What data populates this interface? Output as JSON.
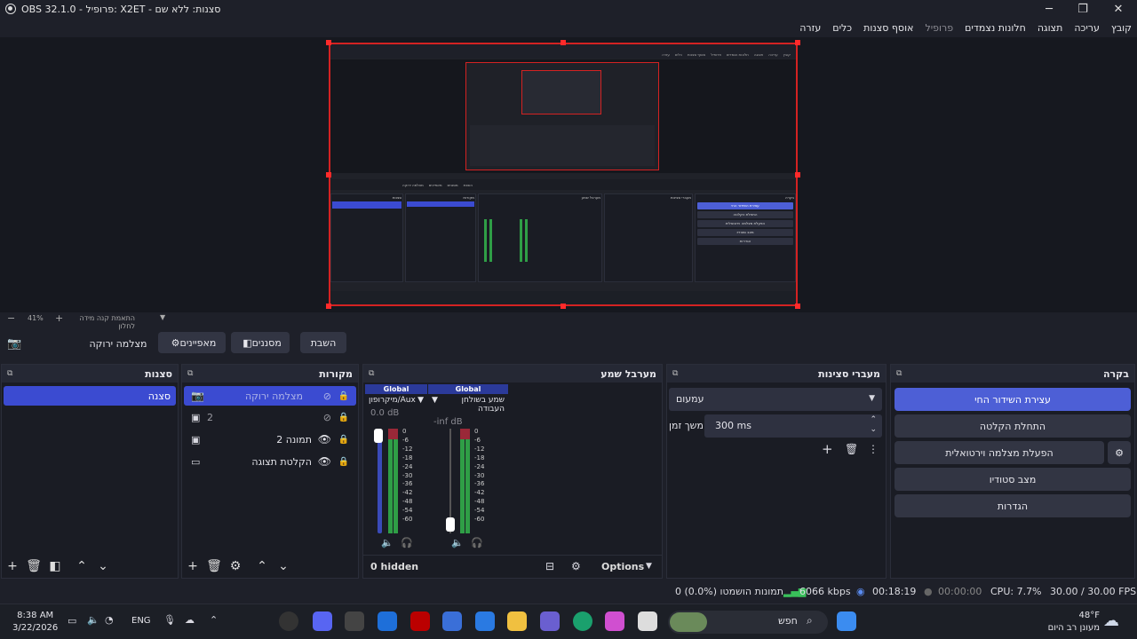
{
  "window": {
    "title": "OBS 32.1.0 - פרופיל: X2ET - סצנות: ללא שם"
  },
  "menu": [
    "קובץ",
    "עריכה",
    "תצוגה",
    "חלונות נצמדים",
    "פרופיל",
    "אוסף סצנות",
    "כלים",
    "עזרה"
  ],
  "nested_preview": {
    "menu": [
      "קובץ",
      "עריכה",
      "תצוגה",
      "חלונות נצמדים",
      "פרופיל",
      "אוסף סצנות",
      "כלים",
      "עזרה"
    ],
    "docks": [
      "סצנות",
      "מקורות",
      "מערבל שמע",
      "מעברי סצינות",
      "בקרה"
    ],
    "buttons": [
      "מצלמה ירוקה",
      "מאפיינים",
      "מסננים",
      "השבת"
    ],
    "controls": [
      "עצירת השידור החי",
      "התחלת הקלטה",
      "הפעלת מצלמה וירטואלית",
      "מצב סטודיו",
      "הגדרות"
    ]
  },
  "zoom": {
    "value": "41%",
    "mode": "התאמת קנה מידה לחלון"
  },
  "source_controls": {
    "selected": "מצלמה ירוקה",
    "properties": "מאפיינים",
    "filters": "מסננים",
    "deactivate": "השבת"
  },
  "scenes": {
    "title": "סצנות",
    "items": [
      "סצנה"
    ]
  },
  "sources": {
    "title": "מקורות",
    "items": [
      {
        "name": "מצלמה ירוקה",
        "icon": "camera-icon",
        "visible": false,
        "selected": true
      },
      {
        "name": "2",
        "icon": "image-icon",
        "visible": false,
        "selected": false
      },
      {
        "name": "תמונה 2",
        "icon": "image-icon",
        "visible": true,
        "selected": false
      },
      {
        "name": "הקלטת תצוגה",
        "icon": "monitor-icon",
        "visible": true,
        "selected": false
      }
    ]
  },
  "mixer": {
    "title": "מערבל שמע",
    "hidden": "0 hidden",
    "options": "Options",
    "channels": [
      {
        "badge": "Global",
        "name": "מיקרופון/Aux",
        "db": "0.0 dB",
        "level": 0.55
      },
      {
        "badge": "Global",
        "name": "שמע בשולחן העבודה",
        "db": "-inf dB",
        "level": 0.75
      }
    ],
    "scale": [
      "0",
      "-6",
      "-12",
      "-18",
      "-24",
      "-30",
      "-36",
      "-42",
      "-48",
      "-54",
      "-60"
    ]
  },
  "transitions": {
    "title": "מעברי סצינות",
    "type": "עמעום",
    "duration_label": "משך זמן",
    "duration": "300 ms"
  },
  "controls": {
    "title": "בקרה",
    "stop_stream": "עצירת השידור החי",
    "start_recording": "התחלת הקלטה",
    "virtual_cam": "הפעלת מצלמה וירטואלית",
    "studio_mode": "מצב סטודיו",
    "settings": "הגדרות"
  },
  "status": {
    "fps": "30.00 / 30.00 FPS",
    "cpu": "CPU: 7.7%",
    "rec_time": "00:00:00",
    "stream_time": "00:18:19",
    "bitrate": "6066 kbps",
    "dropped": "0 תמונות הושמטו (0.0%)"
  },
  "taskbar": {
    "time": "8:38 AM",
    "date": "3/22/2026",
    "lang": "ENG",
    "search": "חפש",
    "weather_temp": "48°F",
    "weather_desc": "מעונן רב היום"
  },
  "colors": {
    "accent": "#4d5fd6",
    "selected_row": "#3b4bd1",
    "preview_border": "#d42222"
  }
}
